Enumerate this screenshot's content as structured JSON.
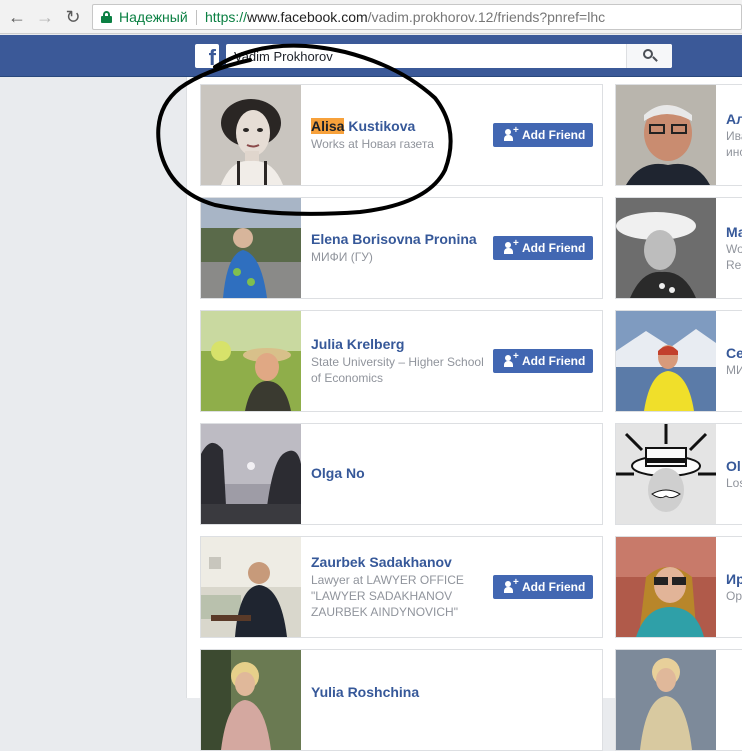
{
  "browser": {
    "secure_label": "Надежный",
    "url_scheme": "https://",
    "url_host": "www.facebook.com",
    "url_path": "/vadim.prokhorov.12/friends?pnref=lhc"
  },
  "fb": {
    "logo": "f",
    "search_value": "Vadim Prokhorov",
    "search_icon": "search-icon"
  },
  "add_friend_label": "Add Friend",
  "friends_left": [
    {
      "name_highlight": "Alisa",
      "name_rest": " Kustikova",
      "sub": "Works at Новая газета",
      "add_friend": true
    },
    {
      "name_highlight": "",
      "name_rest": "Elena Borisovna Pronina",
      "sub": "МИФИ (ГУ)",
      "add_friend": true
    },
    {
      "name_highlight": "",
      "name_rest": "Julia Krelberg",
      "sub": "State University – Higher School of Economics",
      "add_friend": true
    },
    {
      "name_highlight": "",
      "name_rest": "Olga No",
      "sub": "",
      "add_friend": false
    },
    {
      "name_highlight": "",
      "name_rest": "Zaurbek Sadakhanov",
      "sub": "Lawyer at LAWYER OFFICE \"LAWYER SADAKHANOV ZAURBEK AINDYNOVICH\"",
      "add_friend": true
    },
    {
      "name_highlight": "",
      "name_rest": "Yulia Roshchina",
      "sub": "",
      "add_friend": false
    }
  ],
  "friends_right": [
    {
      "name": "Ал",
      "sub1": "Ива",
      "sub2": "инс"
    },
    {
      "name": "Ма",
      "sub1": "Wo",
      "sub2": "Re"
    },
    {
      "name": "Се",
      "sub1": "МИ",
      "sub2": ""
    },
    {
      "name": "Ol",
      "sub1": "Los",
      "sub2": ""
    },
    {
      "name": "Ир",
      "sub1": "Ор",
      "sub2": ""
    },
    {
      "name": "",
      "sub1": "",
      "sub2": ""
    }
  ],
  "colors": {
    "fb_blue": "#3b5998",
    "button_blue": "#4267b2",
    "link_blue": "#365899",
    "highlight": "#f7a13b",
    "secure_green": "#0b8043"
  }
}
